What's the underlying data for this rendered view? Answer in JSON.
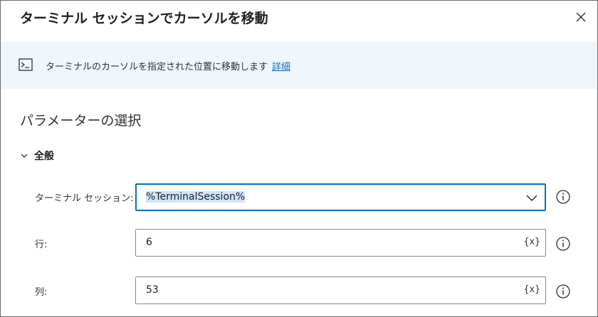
{
  "dialog": {
    "title": "ターミナル セッションでカーソルを移動",
    "close_icon": "close-icon"
  },
  "banner": {
    "icon": "terminal-icon",
    "text": "ターミナルのカーソルを指定された位置に移動します",
    "link_label": "詳細"
  },
  "parameters": {
    "section_title": "パラメーターの選択",
    "group_label": "全般",
    "fields": [
      {
        "label": "ターミナル セッション:",
        "value": "%TerminalSession%",
        "type": "dropdown"
      },
      {
        "label": "行:",
        "value": "6",
        "type": "text",
        "var_button": "{x}"
      },
      {
        "label": "列:",
        "value": "53",
        "type": "text",
        "var_button": "{x}"
      }
    ]
  },
  "colors": {
    "accent": "#0f6cbd",
    "banner_bg": "#eff6fc",
    "selection": "#cfe4fa"
  }
}
